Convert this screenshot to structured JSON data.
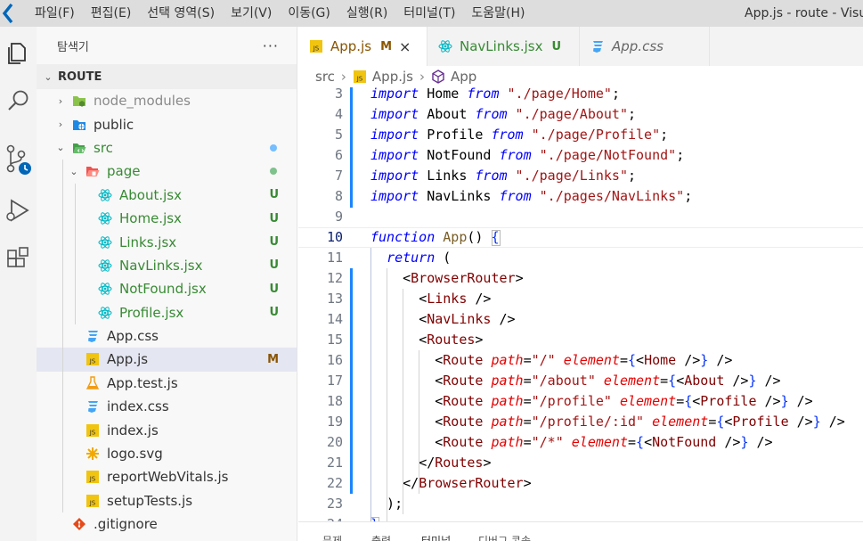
{
  "titlebar": {
    "menus": [
      "파일(F)",
      "편집(E)",
      "선택 영역(S)",
      "보기(V)",
      "이동(G)",
      "실행(R)",
      "터미널(T)",
      "도움말(H)"
    ],
    "window_title": "App.js - route - Visua"
  },
  "activitybar": {
    "icons": [
      "explorer-icon",
      "search-icon",
      "source-control-icon",
      "run-debug-icon",
      "extensions-icon"
    ]
  },
  "sidebar": {
    "title": "탐색기",
    "more": "···",
    "section": "ROUTE",
    "tree": [
      {
        "label": "node_modules",
        "level": 1,
        "arrow": "›",
        "icon": "folder-node-icon",
        "style": "dim"
      },
      {
        "label": "public",
        "level": 1,
        "arrow": "›",
        "icon": "folder-public-icon",
        "style": ""
      },
      {
        "label": "src",
        "level": 1,
        "arrow": "⌄",
        "icon": "folder-src-open-icon",
        "style": "green",
        "dot": "#75beff"
      },
      {
        "label": "page",
        "level": 2,
        "arrow": "⌄",
        "icon": "folder-page-open-icon",
        "style": "green",
        "dot": "#7ec28c"
      },
      {
        "label": "About.jsx",
        "level": 3,
        "icon": "react-icon",
        "style": "green",
        "badge": "U"
      },
      {
        "label": "Home.jsx",
        "level": 3,
        "icon": "react-icon",
        "style": "green",
        "badge": "U"
      },
      {
        "label": "Links.jsx",
        "level": 3,
        "icon": "react-icon",
        "style": "green",
        "badge": "U"
      },
      {
        "label": "NavLinks.jsx",
        "level": 3,
        "icon": "react-icon",
        "style": "green",
        "badge": "U"
      },
      {
        "label": "NotFound.jsx",
        "level": 3,
        "icon": "react-icon",
        "style": "green",
        "badge": "U"
      },
      {
        "label": "Profile.jsx",
        "level": 3,
        "icon": "react-icon",
        "style": "green",
        "badge": "U"
      },
      {
        "label": "App.css",
        "level": 2,
        "icon": "css-icon",
        "style": ""
      },
      {
        "label": "App.js",
        "level": 2,
        "icon": "js-icon",
        "style": "",
        "badge": "M",
        "selected": true
      },
      {
        "label": "App.test.js",
        "level": 2,
        "icon": "test-icon",
        "style": ""
      },
      {
        "label": "index.css",
        "level": 2,
        "icon": "css-icon",
        "style": ""
      },
      {
        "label": "index.js",
        "level": 2,
        "icon": "js-icon",
        "style": ""
      },
      {
        "label": "logo.svg",
        "level": 2,
        "icon": "svg-icon",
        "style": ""
      },
      {
        "label": "reportWebVitals.js",
        "level": 2,
        "icon": "js-icon",
        "style": ""
      },
      {
        "label": "setupTests.js",
        "level": 2,
        "icon": "js-icon",
        "style": ""
      },
      {
        "label": ".gitignore",
        "level": 1,
        "icon": "git-icon",
        "style": ""
      }
    ]
  },
  "tabs": [
    {
      "label": "App.js",
      "icon": "JS",
      "badge": "M",
      "active": true,
      "close": "×"
    },
    {
      "label": "NavLinks.jsx",
      "icon": "react",
      "badge": "U",
      "active": false
    },
    {
      "label": "App.css",
      "icon": "css",
      "active": false
    }
  ],
  "breadcrumb": {
    "parts": [
      "src",
      "App.js",
      "App"
    ],
    "sep": "›"
  },
  "editor": {
    "current_line": 10,
    "lines": [
      {
        "no": 3,
        "tokens": [
          [
            "kw",
            "import"
          ],
          [
            "punc",
            " Home "
          ],
          [
            "kw",
            "from"
          ],
          [
            "str",
            " \"./page/Home\""
          ],
          [
            "punc",
            ";"
          ]
        ]
      },
      {
        "no": 4,
        "tokens": [
          [
            "kw",
            "import"
          ],
          [
            "punc",
            " About "
          ],
          [
            "kw",
            "from"
          ],
          [
            "str",
            " \"./page/About\""
          ],
          [
            "punc",
            ";"
          ]
        ]
      },
      {
        "no": 5,
        "tokens": [
          [
            "kw",
            "import"
          ],
          [
            "punc",
            " Profile "
          ],
          [
            "kw",
            "from"
          ],
          [
            "str",
            " \"./page/Profile\""
          ],
          [
            "punc",
            ";"
          ]
        ]
      },
      {
        "no": 6,
        "tokens": [
          [
            "kw",
            "import"
          ],
          [
            "punc",
            " NotFound "
          ],
          [
            "kw",
            "from"
          ],
          [
            "str",
            " \"./page/NotFound\""
          ],
          [
            "punc",
            ";"
          ]
        ]
      },
      {
        "no": 7,
        "tokens": [
          [
            "kw",
            "import"
          ],
          [
            "punc",
            " Links "
          ],
          [
            "kw",
            "from"
          ],
          [
            "str",
            " \"./page/Links\""
          ],
          [
            "punc",
            ";"
          ]
        ]
      },
      {
        "no": 8,
        "tokens": [
          [
            "kw",
            "import"
          ],
          [
            "punc",
            " NavLinks "
          ],
          [
            "kw",
            "from"
          ],
          [
            "str",
            " \"./pages/NavLinks\""
          ],
          [
            "punc",
            ";"
          ]
        ]
      },
      {
        "no": 9,
        "tokens": []
      },
      {
        "no": 10,
        "tokens": [
          [
            "kw",
            "function"
          ],
          [
            "fn",
            " App"
          ],
          [
            "punc",
            "() "
          ],
          [
            "brace",
            "{"
          ]
        ]
      },
      {
        "no": 11,
        "tokens": [
          [
            "punc",
            "  "
          ],
          [
            "kw-ctrl",
            "return"
          ],
          [
            "punc",
            " ("
          ]
        ]
      },
      {
        "no": 12,
        "tokens": [
          [
            "punc",
            "    "
          ],
          [
            "punc",
            "<"
          ],
          [
            "tag",
            "BrowserRouter"
          ],
          [
            "punc",
            ">"
          ]
        ]
      },
      {
        "no": 13,
        "tokens": [
          [
            "punc",
            "      "
          ],
          [
            "punc",
            "<"
          ],
          [
            "tag",
            "Links"
          ],
          [
            "punc",
            " />"
          ]
        ]
      },
      {
        "no": 14,
        "tokens": [
          [
            "punc",
            "      "
          ],
          [
            "punc",
            "<"
          ],
          [
            "tag",
            "NavLinks"
          ],
          [
            "punc",
            " />"
          ]
        ]
      },
      {
        "no": 15,
        "tokens": [
          [
            "punc",
            "      "
          ],
          [
            "punc",
            "<"
          ],
          [
            "tag",
            "Routes"
          ],
          [
            "punc",
            ">"
          ]
        ]
      },
      {
        "no": 16,
        "tokens": [
          [
            "punc",
            "        "
          ],
          [
            "punc",
            "<"
          ],
          [
            "tag",
            "Route"
          ],
          [
            "attr",
            " path"
          ],
          [
            "punc",
            "="
          ],
          [
            "str",
            "\"/\""
          ],
          [
            "attr",
            " element"
          ],
          [
            "punc",
            "="
          ],
          [
            "jsx-brace",
            "{"
          ],
          [
            "punc",
            "<"
          ],
          [
            "tag",
            "Home"
          ],
          [
            "punc",
            " />"
          ],
          [
            "jsx-brace",
            "}"
          ],
          [
            "punc",
            " />"
          ]
        ]
      },
      {
        "no": 17,
        "tokens": [
          [
            "punc",
            "        "
          ],
          [
            "punc",
            "<"
          ],
          [
            "tag",
            "Route"
          ],
          [
            "attr",
            " path"
          ],
          [
            "punc",
            "="
          ],
          [
            "str",
            "\"/about\""
          ],
          [
            "attr",
            " element"
          ],
          [
            "punc",
            "="
          ],
          [
            "jsx-brace",
            "{"
          ],
          [
            "punc",
            "<"
          ],
          [
            "tag",
            "About"
          ],
          [
            "punc",
            " />"
          ],
          [
            "jsx-brace",
            "}"
          ],
          [
            "punc",
            " />"
          ]
        ]
      },
      {
        "no": 18,
        "tokens": [
          [
            "punc",
            "        "
          ],
          [
            "punc",
            "<"
          ],
          [
            "tag",
            "Route"
          ],
          [
            "attr",
            " path"
          ],
          [
            "punc",
            "="
          ],
          [
            "str",
            "\"/profile\""
          ],
          [
            "attr",
            " element"
          ],
          [
            "punc",
            "="
          ],
          [
            "jsx-brace",
            "{"
          ],
          [
            "punc",
            "<"
          ],
          [
            "tag",
            "Profile"
          ],
          [
            "punc",
            " />"
          ],
          [
            "jsx-brace",
            "}"
          ],
          [
            "punc",
            " />"
          ]
        ]
      },
      {
        "no": 19,
        "tokens": [
          [
            "punc",
            "        "
          ],
          [
            "punc",
            "<"
          ],
          [
            "tag",
            "Route"
          ],
          [
            "attr",
            " path"
          ],
          [
            "punc",
            "="
          ],
          [
            "str",
            "\"/profile/:id\""
          ],
          [
            "attr",
            " element"
          ],
          [
            "punc",
            "="
          ],
          [
            "jsx-brace",
            "{"
          ],
          [
            "punc",
            "<"
          ],
          [
            "tag",
            "Profile"
          ],
          [
            "punc",
            " />"
          ],
          [
            "jsx-brace",
            "}"
          ],
          [
            "punc",
            " />"
          ]
        ]
      },
      {
        "no": 20,
        "tokens": [
          [
            "punc",
            "        "
          ],
          [
            "punc",
            "<"
          ],
          [
            "tag",
            "Route"
          ],
          [
            "attr",
            " path"
          ],
          [
            "punc",
            "="
          ],
          [
            "str",
            "\"/*\""
          ],
          [
            "attr",
            " element"
          ],
          [
            "punc",
            "="
          ],
          [
            "jsx-brace",
            "{"
          ],
          [
            "punc",
            "<"
          ],
          [
            "tag",
            "NotFound"
          ],
          [
            "punc",
            " />"
          ],
          [
            "jsx-brace",
            "}"
          ],
          [
            "punc",
            " />"
          ]
        ]
      },
      {
        "no": 21,
        "tokens": [
          [
            "punc",
            "      "
          ],
          [
            "punc",
            "</"
          ],
          [
            "tag",
            "Routes"
          ],
          [
            "punc",
            ">"
          ]
        ]
      },
      {
        "no": 22,
        "tokens": [
          [
            "punc",
            "    "
          ],
          [
            "punc",
            "</"
          ],
          [
            "tag",
            "BrowserRouter"
          ],
          [
            "punc",
            ">"
          ]
        ]
      },
      {
        "no": 23,
        "tokens": [
          [
            "punc",
            "  );"
          ]
        ]
      },
      {
        "no": 24,
        "tokens": [
          [
            "brace",
            "}"
          ]
        ]
      }
    ]
  },
  "panel": {
    "tabs": [
      "문제",
      "출력",
      "터미널",
      "디버그 콘솔"
    ]
  },
  "colors": {
    "accent": "#0066b8",
    "untracked": "#388a34",
    "modified": "#895503"
  }
}
